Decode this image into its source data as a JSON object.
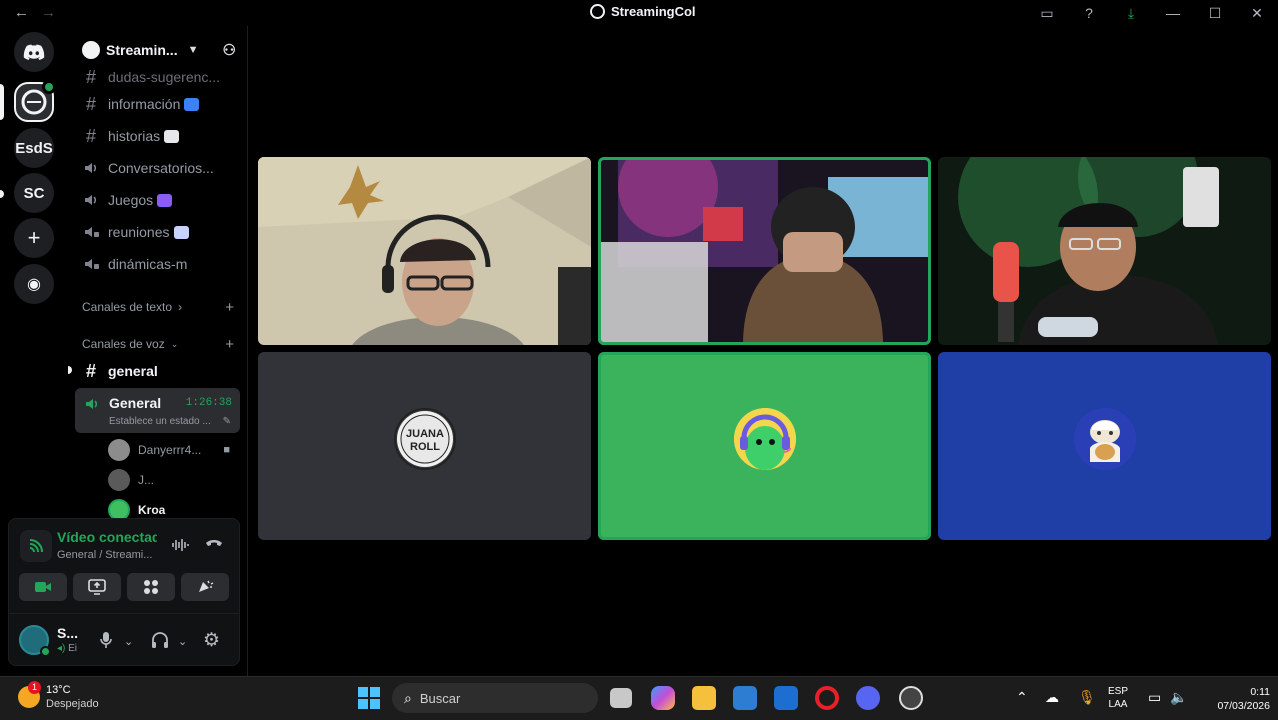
{
  "window": {
    "title": "StreamingCol",
    "nav_back": "←",
    "nav_forward": "→",
    "controls": [
      "▭",
      "?",
      "⤓",
      "—",
      "☐",
      "✕"
    ]
  },
  "rail": {
    "servers": [
      {
        "label": "",
        "icon": "discord-home-icon"
      },
      {
        "label": "",
        "icon": "streamingcol-server-icon"
      },
      {
        "label": "EsdS"
      },
      {
        "label": "SC"
      },
      {
        "label": "+",
        "icon": "add-server-icon"
      },
      {
        "label": "◉",
        "icon": "explore-icon"
      }
    ]
  },
  "sidebar": {
    "server_name": "Streamin...",
    "channels_top": [
      {
        "name": "dudas-sugerenc...",
        "type": "text"
      },
      {
        "name": "información",
        "type": "text",
        "emoji_color": "#3b82f6"
      },
      {
        "name": "historias",
        "type": "text",
        "emoji_color": "#e5e7eb"
      },
      {
        "name": "Conversatorios...",
        "type": "voice"
      },
      {
        "name": "Juegos",
        "type": "voice",
        "emoji_color": "#8b5cf6"
      },
      {
        "name": "reuniones",
        "type": "voice-locked",
        "emoji_color": "#c7d2fe"
      },
      {
        "name": "dinámicas-m",
        "type": "voice-locked"
      }
    ],
    "category_text": "Canales de texto",
    "category_voice": "Canales de voz",
    "general_text": "general",
    "voice_channel": {
      "name": "General",
      "duration": "1:26:38",
      "status": "Establece un estado ..."
    },
    "voice_users": [
      {
        "name": "Danyerrr4...",
        "camera": true,
        "color": "#8c8c8c"
      },
      {
        "name": "J...",
        "camera": false,
        "color": "#5a5a5a"
      },
      {
        "name": "Kroa",
        "camera": false,
        "color": "#3fbf5f"
      }
    ]
  },
  "voice_panel": {
    "title": "Vídeo conectad",
    "subtitle": "General / Streami...",
    "user_name": "S...",
    "user_status": "Ei"
  },
  "tiles": [
    {
      "kind": "video",
      "scene": "room-light",
      "speaking": false
    },
    {
      "kind": "video",
      "scene": "room-purple",
      "speaking": true
    },
    {
      "kind": "video",
      "scene": "room-green",
      "speaking": false
    },
    {
      "kind": "avatar",
      "bg": "#313338",
      "avatar_text": "JUANA ROLL",
      "speaking": false
    },
    {
      "kind": "avatar",
      "bg": "#3bb35c",
      "speaking": true
    },
    {
      "kind": "avatar",
      "bg": "#1f3ea6",
      "speaking": false
    }
  ],
  "taskbar": {
    "weather_temp": "13°C",
    "weather_cond": "Despejado",
    "weather_badge": "1",
    "search_placeholder": "Buscar",
    "lang_line1": "ESP",
    "lang_line2": "LAA",
    "time": "0:11",
    "date": "07/03/2026"
  }
}
